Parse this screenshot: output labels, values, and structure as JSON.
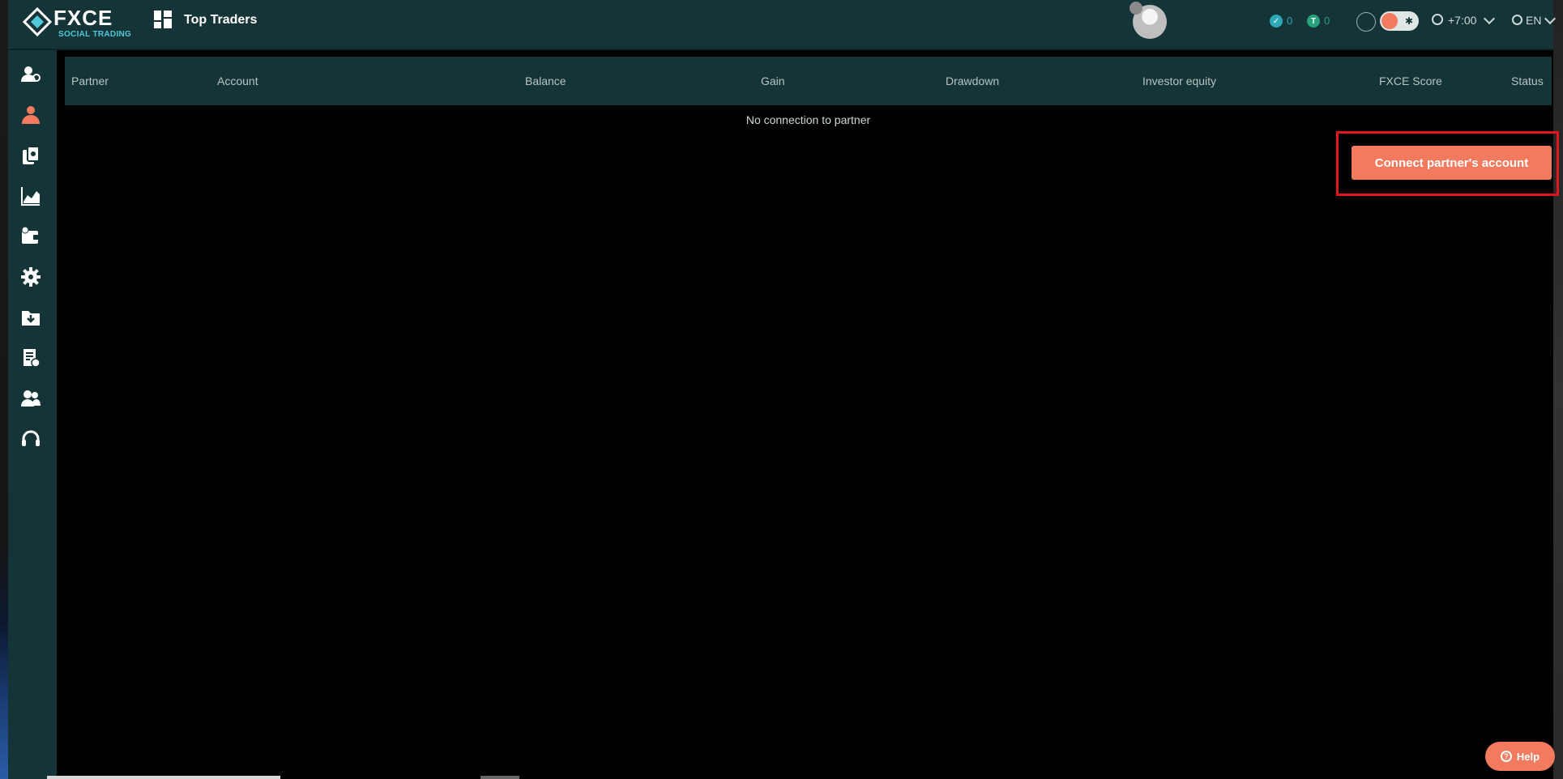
{
  "brand": {
    "name": "FXCE",
    "tagline": "SOCIAL TRADING"
  },
  "header": {
    "page_title": "Top Traders",
    "user_name": "",
    "coin_a_balance": "0",
    "coin_b_balance": "0",
    "coin_b_symbol": "T",
    "timezone": "+7:00",
    "language": "EN"
  },
  "sidebar": {
    "items": [
      {
        "icon": "users-icon",
        "active": false
      },
      {
        "icon": "partner-icon",
        "active": true
      },
      {
        "icon": "copy-trade-icon",
        "active": false
      },
      {
        "icon": "chart-area-icon",
        "active": false
      },
      {
        "icon": "wallet-icon",
        "active": false
      },
      {
        "icon": "gear-icon",
        "active": false
      },
      {
        "icon": "folder-download-icon",
        "active": false
      },
      {
        "icon": "report-icon",
        "active": false
      },
      {
        "icon": "group-icon",
        "active": false
      },
      {
        "icon": "headset-icon",
        "active": false
      }
    ]
  },
  "table": {
    "columns": [
      "Partner",
      "Account",
      "Balance",
      "Gain",
      "Drawdown",
      "Investor equity",
      "FXCE Score",
      "Status"
    ],
    "empty_message": "No connection to partner"
  },
  "actions": {
    "connect_label": "Connect partner's account"
  },
  "help": {
    "label": "Help"
  },
  "colors": {
    "accent": "#f27a5e",
    "panel": "#143437",
    "teal": "#2fa8b9",
    "green": "#26a17b",
    "highlight": "#e0181e"
  }
}
